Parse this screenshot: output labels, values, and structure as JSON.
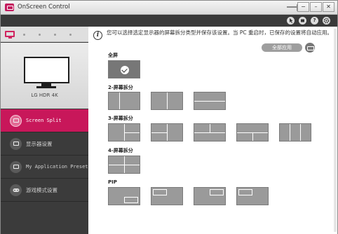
{
  "window": {
    "title": "OnScreen Control",
    "controls": {
      "minimize": "−",
      "maximize": "–",
      "close": "✕"
    }
  },
  "toolbar": {
    "icons": [
      "cursor-icon",
      "screen-icon",
      "help-icon",
      "settings-icon"
    ],
    "help_label": "?"
  },
  "sidebar": {
    "monitor_name": "LG HDR 4K",
    "items": [
      {
        "label": "Screen Split",
        "icon": "screen-split-icon",
        "active": true
      },
      {
        "label": "显示器设置",
        "icon": "monitor-settings-icon",
        "active": false
      },
      {
        "label": "My Application Preset",
        "icon": "app-preset-icon",
        "active": false
      },
      {
        "label": "游戏模式设置",
        "icon": "gamepad-icon",
        "active": false
      }
    ]
  },
  "content": {
    "info_text": "您可以选择选定显示器的屏幕拆分类型并保存该设置。当 PC 重启时，已保存的设置将自动应用。",
    "apply_all_label": "全部应用",
    "sections": {
      "full": "全屏",
      "split2": "2-屏幕拆分",
      "split3": "3-屏幕拆分",
      "split4": "4-屏幕拆分",
      "pip": "PIP"
    }
  },
  "colors": {
    "accent": "#c8175a",
    "sidebar_bg": "#3b3b3b",
    "thumb": "#9a9a9a"
  }
}
